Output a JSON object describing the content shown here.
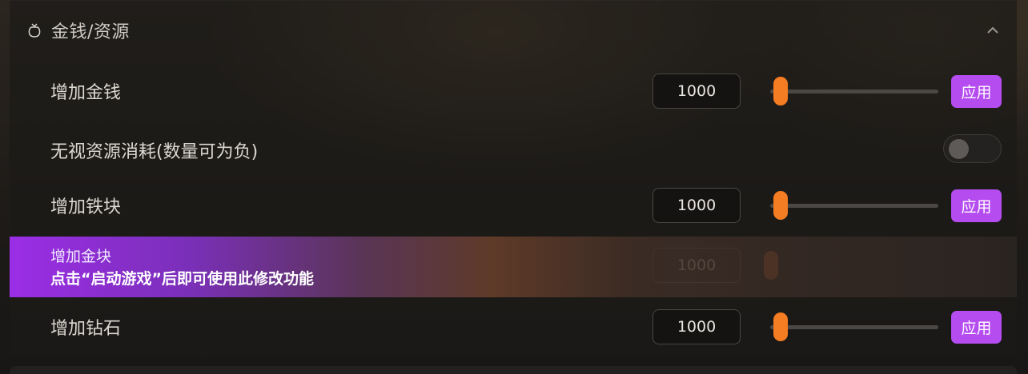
{
  "section": {
    "title": "金钱/资源",
    "icon": "money-bag-icon",
    "collapse_icon": "chevron-up-icon"
  },
  "rows": [
    {
      "label": "增加金钱",
      "value": "1000",
      "slider_fraction": 0.0,
      "apply_label": "应用"
    },
    {
      "label": "无视资源消耗(数量可为负)",
      "toggle_on": false
    },
    {
      "label": "增加铁块",
      "value": "1000",
      "slider_fraction": 0.0,
      "apply_label": "应用"
    },
    {
      "label": "增加金块",
      "value": "1000",
      "locked_message": "点击“启动游戏”后即可使用此修改功能"
    },
    {
      "label": "增加钻石",
      "value": "1000",
      "slider_fraction": 0.0,
      "apply_label": "应用"
    }
  ],
  "colors": {
    "accent_purple": "#b44cf0",
    "slider_orange": "#f47c22"
  }
}
